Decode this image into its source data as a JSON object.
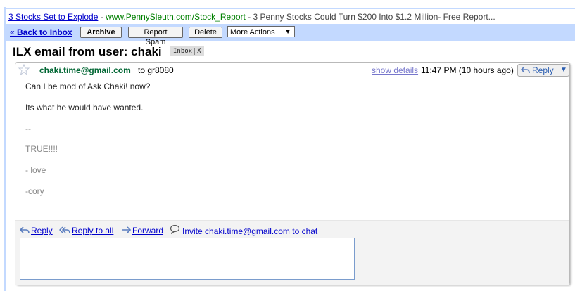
{
  "ad": {
    "link": "3 Stocks Set to Explode",
    "separator": " - ",
    "url": "www.PennySleuth.com/Stock_Report",
    "text": " - 3 Penny Stocks Could Turn $200 Into $1.2 Million- Free Report..."
  },
  "toolbar": {
    "back_label": "« Back to Inbox",
    "archive_label": "Archive",
    "report_spam_label": "Report Spam",
    "delete_label": "Delete",
    "more_actions_label": "More Actions",
    "more_actions_arrow": "▼"
  },
  "thread": {
    "subject": "ILX email from user: chaki",
    "label": "Inbox",
    "label_remove": "X"
  },
  "message": {
    "sender": "chaki.time@gmail.com",
    "to_line": "to gr8080",
    "show_details": "show details",
    "timestamp": "11:47 PM (10 hours ago)",
    "reply_label": "Reply",
    "reply_dropdown": "▼",
    "body": {
      "line1": "Can I be mod of Ask Chaki! now?",
      "line2": "Its what he would have wanted.",
      "sig_dash": "--",
      "sig1": "TRUE!!!!",
      "sig2": "- love",
      "sig3": "-cory"
    }
  },
  "actions": {
    "reply": "Reply",
    "reply_all": "Reply to all",
    "forward": "Forward",
    "invite": "Invite chaki.time@gmail.com to chat"
  },
  "colors": {
    "toolbar_bg": "#c3d9ff",
    "link": "#0000cc",
    "sender": "#006633",
    "ad_url": "#008000"
  }
}
